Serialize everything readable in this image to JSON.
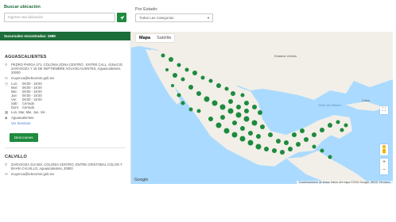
{
  "search": {
    "label": "Buscar ubicación",
    "placeholder": "Ingrese una ubicación"
  },
  "filter": {
    "label": "Por Estado:",
    "selected": "Todas Las Categorias"
  },
  "sidebar": {
    "header": "Sucursales encontradas: 1888",
    "stores": [
      {
        "name": "AGUASCALIENTES",
        "address": "PEDRO PARGA 271, COLONIA ZONA CENTRO , ENTRE CALL. IGNACIO ZARAGOZA Y 16 DE SEPTIEMBRE AGUASCALIENTES, Aguascalientes, 20000",
        "email": "muyenca@telecomm.gob.mx",
        "hours": [
          {
            "day": "Lun:",
            "time": "08:00 - 18:00"
          },
          {
            "day": "Mar:",
            "time": "08:00 - 18:00"
          },
          {
            "day": "Mie:",
            "time": "08:00 - 18:00"
          },
          {
            "day": "Jue:",
            "time": "08:00 - 18:00"
          },
          {
            "day": "Vie:",
            "time": "08:00 - 18:00"
          },
          {
            "day": "Sab:",
            "time": "Cerrado"
          },
          {
            "day": "Dom:",
            "time": "Cerrado"
          }
        ],
        "days": "Lun, Mar, Mie, Jue, Vie",
        "category": "Aguascalientes",
        "services_link": "Ver Servicios",
        "directions": "Direcciones"
      },
      {
        "name": "CALVILLO",
        "address": "ZARAGOZA 212 BIS, COLONIA CENTRO, ENTRE CRISTOBAL COLON Y BAHÍA CALVILLO, Aguascalientes, 20800",
        "email": "muyenca@telecomm.gob.mx"
      }
    ]
  },
  "map": {
    "tabs": [
      "Mapa",
      "Satélite"
    ],
    "active_tab": "Mapa",
    "labels": {
      "gulf": "Golfo de México",
      "cuba": "Cuba",
      "usa": "Estados Unidos"
    },
    "attribution": "Combinaciones de teclas   Datos del mapa ©2024 Google, INEGI   Términos",
    "google": "Google",
    "zoom_in": "+",
    "zoom_out": "−",
    "marker_color": "#1e8a3e"
  }
}
